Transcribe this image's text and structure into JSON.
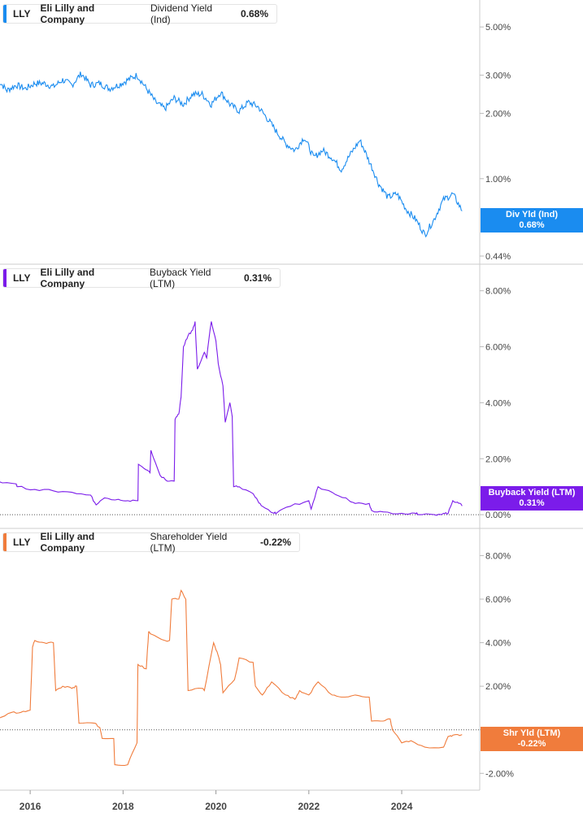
{
  "chart_data": [
    {
      "type": "line",
      "ticker": "LLY",
      "company": "Eli Lilly and Company",
      "metric": "Dividend Yield (Ind)",
      "current_value": "0.68%",
      "flag_label": "Div Yld (Ind)",
      "flag_value": "0.68%",
      "color": "#1a8cf0",
      "scale": "log",
      "yticks": [
        {
          "v": 5.0,
          "label": "5.00%"
        },
        {
          "v": 3.0,
          "label": "3.00%"
        },
        {
          "v": 2.0,
          "label": "2.00%"
        },
        {
          "v": 1.0,
          "label": "1.00%"
        },
        {
          "v": 0.44,
          "label": "0.44%"
        }
      ],
      "ylim": [
        0.44,
        6.0
      ],
      "series": [
        {
          "x": [
            2015.3,
            2015.5,
            2015.7,
            2015.9,
            2016.1,
            2016.3,
            2016.5,
            2016.7,
            2016.9,
            2017.1,
            2017.3,
            2017.5,
            2017.7,
            2017.9,
            2018.1,
            2018.3,
            2018.5,
            2018.7,
            2018.9,
            2019.1,
            2019.3,
            2019.5,
            2019.7,
            2019.9,
            2020.1,
            2020.3,
            2020.5,
            2020.7,
            2020.9,
            2021.1,
            2021.3,
            2021.5,
            2021.7,
            2021.9,
            2022.1,
            2022.3,
            2022.5,
            2022.7,
            2022.9,
            2023.1,
            2023.3,
            2023.5,
            2023.7,
            2023.9,
            2024.1,
            2024.3,
            2024.5,
            2024.7,
            2024.9,
            2025.1,
            2025.3
          ],
          "values": [
            2.85,
            2.55,
            2.7,
            2.6,
            2.75,
            2.75,
            2.65,
            2.85,
            2.7,
            3.05,
            2.7,
            2.75,
            2.6,
            2.7,
            2.85,
            3.0,
            2.6,
            2.25,
            2.1,
            2.35,
            2.2,
            2.45,
            2.45,
            2.2,
            2.5,
            2.2,
            2.05,
            2.25,
            2.15,
            1.9,
            1.65,
            1.45,
            1.35,
            1.55,
            1.25,
            1.35,
            1.25,
            1.1,
            1.3,
            1.5,
            1.2,
            0.95,
            0.82,
            0.85,
            0.72,
            0.65,
            0.55,
            0.65,
            0.8,
            0.85,
            0.71
          ]
        }
      ]
    },
    {
      "type": "line",
      "ticker": "LLY",
      "company": "Eli Lilly and Company",
      "metric": "Buyback Yield (LTM)",
      "current_value": "0.31%",
      "flag_label": "Buyback Yield (LTM)",
      "flag_value": "0.31%",
      "color": "#7b1cea",
      "scale": "linear",
      "yticks": [
        {
          "v": 8.0,
          "label": "8.00%"
        },
        {
          "v": 6.0,
          "label": "6.00%"
        },
        {
          "v": 4.0,
          "label": "4.00%"
        },
        {
          "v": 2.0,
          "label": "2.00%"
        },
        {
          "v": 0.0,
          "label": "0.00%"
        }
      ],
      "ylim": [
        -0.2,
        8.6
      ],
      "series": [
        {
          "x": [
            2015.3,
            2015.7,
            2015.72,
            2016.1,
            2016.5,
            2016.9,
            2017.3,
            2017.42,
            2017.6,
            2017.9,
            2018.1,
            2018.32,
            2018.33,
            2018.5,
            2018.58,
            2018.6,
            2018.8,
            2018.95,
            2019.1,
            2019.12,
            2019.2,
            2019.25,
            2019.3,
            2019.4,
            2019.5,
            2019.55,
            2019.6,
            2019.75,
            2019.8,
            2019.9,
            2020.0,
            2020.05,
            2020.15,
            2020.2,
            2020.3,
            2020.35,
            2020.38,
            2020.5,
            2020.8,
            2020.9,
            2021.0,
            2021.25,
            2021.3,
            2021.6,
            2022.0,
            2022.05,
            2022.2,
            2022.5,
            2022.8,
            2023.0,
            2023.3,
            2023.35,
            2023.6,
            2024.0,
            2024.3,
            2024.35,
            2024.7,
            2024.9,
            2025.0,
            2025.1,
            2025.2,
            2025.3
          ],
          "values": [
            1.2,
            1.1,
            1.0,
            0.9,
            0.85,
            0.8,
            0.7,
            0.35,
            0.6,
            0.55,
            0.5,
            0.5,
            1.8,
            1.6,
            1.5,
            2.3,
            1.4,
            1.2,
            1.2,
            3.4,
            3.6,
            4.2,
            6.0,
            6.4,
            6.6,
            6.9,
            5.2,
            5.8,
            5.6,
            6.9,
            6.2,
            5.4,
            4.6,
            3.3,
            4.0,
            3.5,
            1.0,
            1.0,
            0.75,
            0.5,
            0.3,
            0.05,
            0.05,
            0.3,
            0.5,
            0.2,
            1.0,
            0.8,
            0.6,
            0.4,
            0.4,
            0.15,
            0.1,
            0.05,
            0.05,
            0.0,
            0.0,
            0.05,
            0.05,
            0.5,
            0.45,
            0.31
          ]
        }
      ]
    },
    {
      "type": "line",
      "ticker": "LLY",
      "company": "Eli Lilly and Company",
      "metric": "Shareholder Yield (LTM)",
      "current_value": "-0.22%",
      "flag_label": "Shr Yld (LTM)",
      "flag_value": "-0.22%",
      "color": "#f07c3c",
      "scale": "linear",
      "yticks": [
        {
          "v": 8.0,
          "label": "8.00%"
        },
        {
          "v": 6.0,
          "label": "6.00%"
        },
        {
          "v": 4.0,
          "label": "4.00%"
        },
        {
          "v": 2.0,
          "label": "2.00%"
        },
        {
          "v": 0.0,
          "label": "0.00%"
        },
        {
          "v": -2.0,
          "label": "-2.00%"
        }
      ],
      "ylim": [
        -2.4,
        8.8
      ],
      "series": [
        {
          "x": [
            2015.3,
            2015.6,
            2015.8,
            2016.0,
            2016.05,
            2016.1,
            2016.3,
            2016.5,
            2016.55,
            2016.7,
            2016.9,
            2017.0,
            2017.05,
            2017.4,
            2017.5,
            2017.55,
            2017.8,
            2017.82,
            2018.1,
            2018.3,
            2018.32,
            2018.5,
            2018.55,
            2018.6,
            2018.9,
            2019.0,
            2019.05,
            2019.2,
            2019.25,
            2019.35,
            2019.4,
            2019.7,
            2019.75,
            2019.95,
            2020.05,
            2020.1,
            2020.15,
            2020.4,
            2020.5,
            2020.8,
            2020.85,
            2021.0,
            2021.2,
            2021.5,
            2021.7,
            2021.8,
            2022.0,
            2022.2,
            2022.5,
            2022.7,
            2023.0,
            2023.3,
            2023.35,
            2023.6,
            2023.75,
            2023.8,
            2024.0,
            2024.2,
            2024.5,
            2024.9,
            2025.0,
            2025.1,
            2025.3
          ],
          "values": [
            0.5,
            0.8,
            0.8,
            0.9,
            3.8,
            4.1,
            4.0,
            4.0,
            1.8,
            2.0,
            1.9,
            2.0,
            0.3,
            0.3,
            0.1,
            -0.4,
            -0.4,
            -1.6,
            -1.6,
            -0.6,
            3.0,
            2.8,
            4.5,
            4.4,
            4.1,
            4.1,
            6.0,
            6.0,
            6.4,
            6.0,
            1.8,
            1.9,
            1.8,
            4.0,
            3.4,
            3.0,
            1.7,
            2.3,
            3.3,
            3.1,
            2.0,
            1.6,
            2.2,
            1.6,
            1.4,
            1.8,
            1.6,
            2.2,
            1.6,
            1.5,
            1.6,
            1.5,
            0.4,
            0.4,
            0.5,
            0.0,
            -0.6,
            -0.5,
            -0.8,
            -0.8,
            -0.3,
            -0.25,
            -0.22
          ]
        }
      ]
    }
  ],
  "x_axis": {
    "ticks": [
      {
        "v": 2016,
        "label": "2016"
      },
      {
        "v": 2018,
        "label": "2018"
      },
      {
        "v": 2020,
        "label": "2020"
      },
      {
        "v": 2022,
        "label": "2022"
      },
      {
        "v": 2024,
        "label": "2024"
      }
    ],
    "range": [
      2015.35,
      2025.68
    ]
  }
}
